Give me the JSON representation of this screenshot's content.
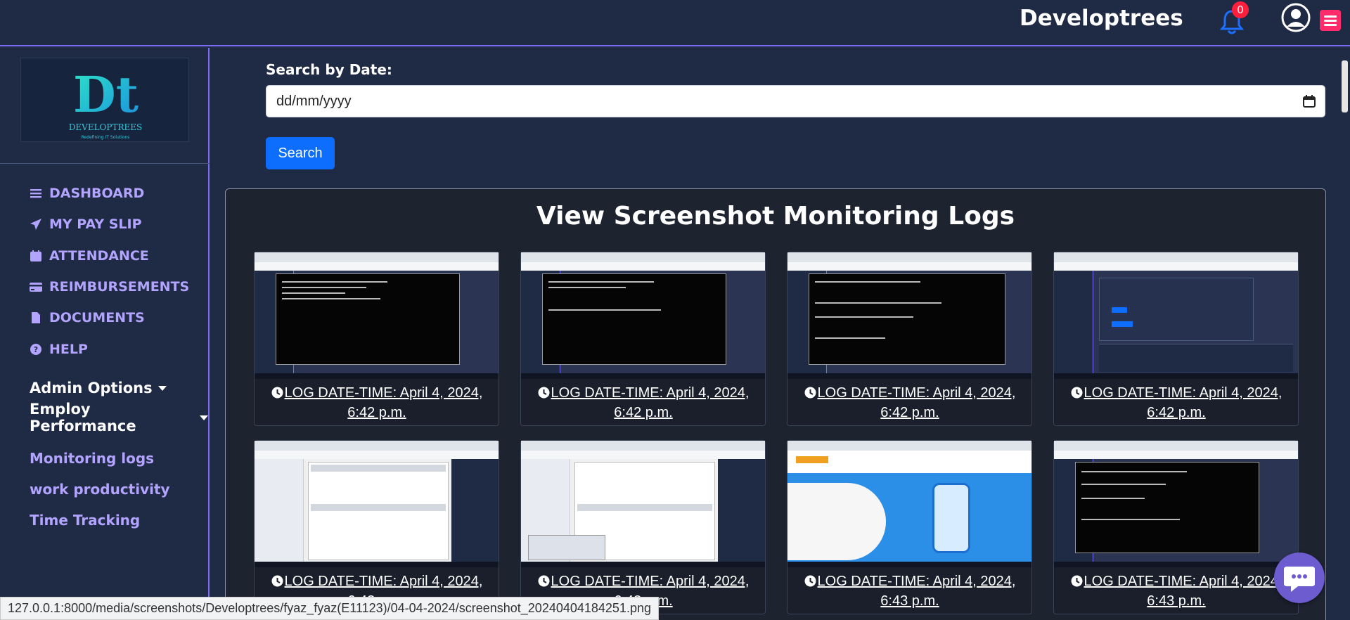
{
  "header": {
    "brand": "Developtrees",
    "notification_count": "0"
  },
  "sidebar": {
    "logo_text": "DEVELOPTREES",
    "logo_tagline": "Redefining IT Solutions",
    "logo_mark": "Dt",
    "nav": [
      {
        "label": "DASHBOARD",
        "icon": "list-icon"
      },
      {
        "label": "MY PAY SLIP",
        "icon": "paper-plane-icon"
      },
      {
        "label": "ATTENDANCE",
        "icon": "calendar-icon"
      },
      {
        "label": "REIMBURSEMENTS",
        "icon": "credit-card-icon"
      },
      {
        "label": "DOCUMENTS",
        "icon": "file-icon"
      },
      {
        "label": "HELP",
        "icon": "question-icon"
      }
    ],
    "admin_options": "Admin Options",
    "employ_performance": "Employ Performance",
    "sub_links": [
      "Monitoring logs",
      "work productivity",
      "Time Tracking"
    ]
  },
  "main": {
    "search_label": "Search by Date:",
    "date_placeholder": "dd/mm/yyyy",
    "search_button": "Search",
    "panel_title": "View Screenshot Monitoring Logs",
    "logs": [
      {
        "caption": "LOG DATE-TIME: April 4, 2024, 6:42 p.m.",
        "kind": "terminal"
      },
      {
        "caption": "LOG DATE-TIME: April 4, 2024, 6:42 p.m.",
        "kind": "terminal"
      },
      {
        "caption": "LOG DATE-TIME: April 4, 2024, 6:42 p.m.",
        "kind": "terminal"
      },
      {
        "caption": "LOG DATE-TIME: April 4, 2024, 6:42 p.m.",
        "kind": "attendance"
      },
      {
        "caption": "LOG DATE-TIME: April 4, 2024, 6:43 p.m.",
        "kind": "phpmyadmin"
      },
      {
        "caption": "LOG DATE-TIME: April 4, 2024, 6:43 p.m.",
        "kind": "phpmyadmin"
      },
      {
        "caption": "LOG DATE-TIME: April 4, 2024, 6:43 p.m.",
        "kind": "website"
      },
      {
        "caption": "LOG DATE-TIME: April 4, 2024, 6:43 p.m.",
        "kind": "terminal"
      }
    ]
  },
  "status_url": "127.0.0.1:8000/media/screenshots/Developtrees/fyaz_fyaz(E11123)/04-04-2024/screenshot_20240404184251.png",
  "colors": {
    "background": "#1f2a44",
    "accent": "#7b6cf6",
    "nav_text": "#b2a4ff",
    "primary_button": "#0d6efd",
    "badge": "#ff1f3d"
  }
}
